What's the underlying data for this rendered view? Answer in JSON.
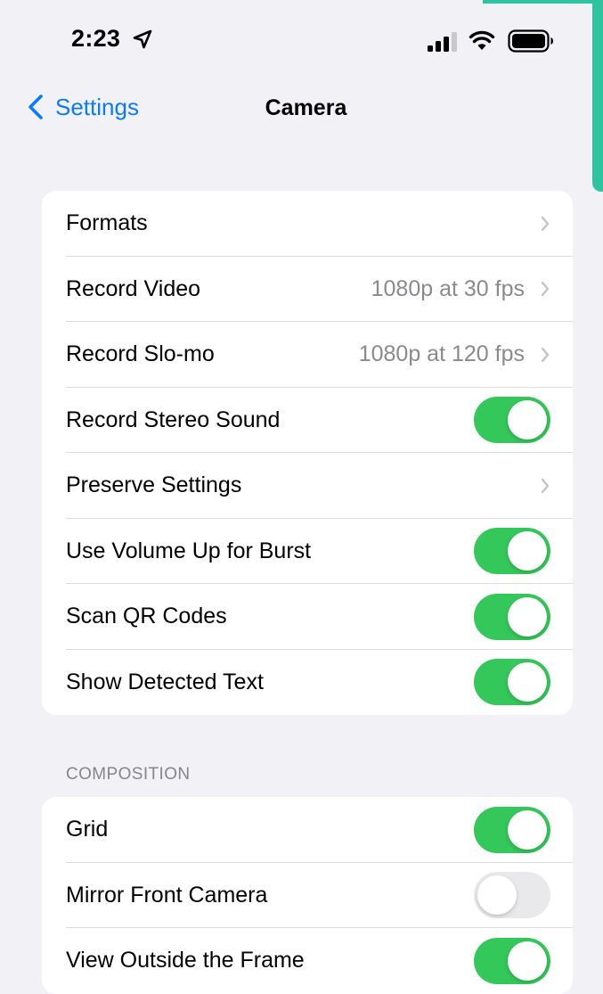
{
  "status_bar": {
    "time": "2:23"
  },
  "nav": {
    "back_label": "Settings",
    "title": "Camera"
  },
  "main_group": {
    "rows": [
      {
        "label": "Formats",
        "value": "",
        "control": "chevron"
      },
      {
        "label": "Record Video",
        "value": "1080p at 30 fps",
        "control": "chevron"
      },
      {
        "label": "Record Slo-mo",
        "value": "1080p at 120 fps",
        "control": "chevron"
      },
      {
        "label": "Record Stereo Sound",
        "control": "toggle",
        "on": true
      },
      {
        "label": "Preserve Settings",
        "value": "",
        "control": "chevron"
      },
      {
        "label": "Use Volume Up for Burst",
        "control": "toggle",
        "on": true
      },
      {
        "label": "Scan QR Codes",
        "control": "toggle",
        "on": true
      },
      {
        "label": "Show Detected Text",
        "control": "toggle",
        "on": true
      }
    ]
  },
  "composition": {
    "header": "COMPOSITION",
    "rows": [
      {
        "label": "Grid",
        "control": "toggle",
        "on": true
      },
      {
        "label": "Mirror Front Camera",
        "control": "toggle",
        "on": false
      },
      {
        "label": "View Outside the Frame",
        "control": "toggle",
        "on": true
      }
    ]
  },
  "colors": {
    "accent_blue": "#0a7aff",
    "toggle_on": "#34c759",
    "toggle_off": "#e9e9eb",
    "background": "#f2f1f6",
    "secondary_text": "#8a8a8e"
  },
  "icons": [
    "location-arrow-icon",
    "cellular-signal-icon",
    "wifi-icon",
    "battery-icon",
    "back-chevron-icon",
    "chevron-right-icon"
  ]
}
